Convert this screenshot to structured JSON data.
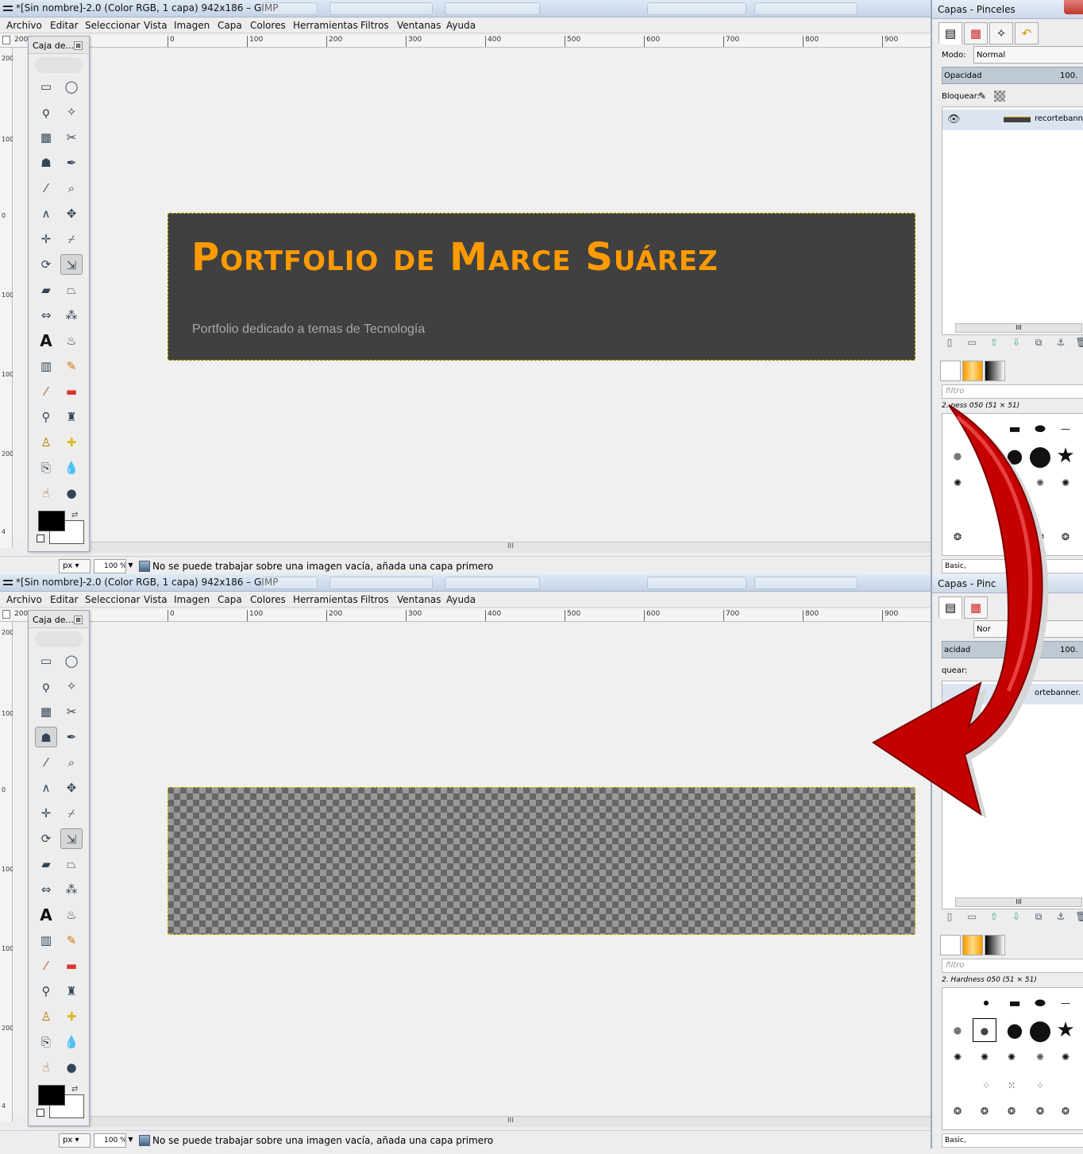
{
  "window": {
    "title": "*[Sin nombre]-2.0 (Color RGB, 1 capa) 942x186 – GIMP"
  },
  "menu": [
    "Archivo",
    "Editar",
    "Seleccionar",
    "Vista",
    "Imagen",
    "Capa",
    "Colores",
    "Herramientas",
    "Filtros",
    "Ventanas",
    "Ayuda"
  ],
  "ruler": {
    "h_labels": [
      "200",
      "0",
      "100",
      "200",
      "300",
      "400",
      "500",
      "600",
      "700",
      "800",
      "900"
    ],
    "v_labels": [
      "200",
      "100",
      "0",
      "100",
      "200",
      "300",
      "4"
    ]
  },
  "toolbox": {
    "title": "Caja de...",
    "close": "⊠"
  },
  "banner": {
    "title": "Portfolio de Marce Suárez",
    "subtitle": "Portfolio dedicado a temas de Tecnología"
  },
  "status": {
    "unit": "px",
    "zoom": "100 %",
    "message": "No se puede trabajar sobre una imagen vacía, añada una capa primero"
  },
  "scroll_grip": "III",
  "dock": {
    "title_top": "Capas - Pinceles",
    "title_bottom": "Capas - Pinc",
    "mode_label": "Modo:",
    "mode_value": "Normal",
    "mode_value_bottom": "Nor",
    "opacity_label": "Opacidad",
    "opacity_label_bottom": "acidad",
    "opacity_value": "100.",
    "lock_label": "Bloquear:",
    "lock_label_bottom": "quear:",
    "layer_name": "recortebanner.",
    "layer_name_bottom": "ortebanner.",
    "brush_filter": "filtro",
    "brush_name": "2. Hardness 050 (51 × 51)",
    "brush_name_top": "2.  ness 050 (51 × 51)",
    "brush_set": "Basic,"
  },
  "colors": {
    "banner_bg": "#404040",
    "title_orange": "#ff9a00",
    "arrow_red": "#c40000"
  }
}
